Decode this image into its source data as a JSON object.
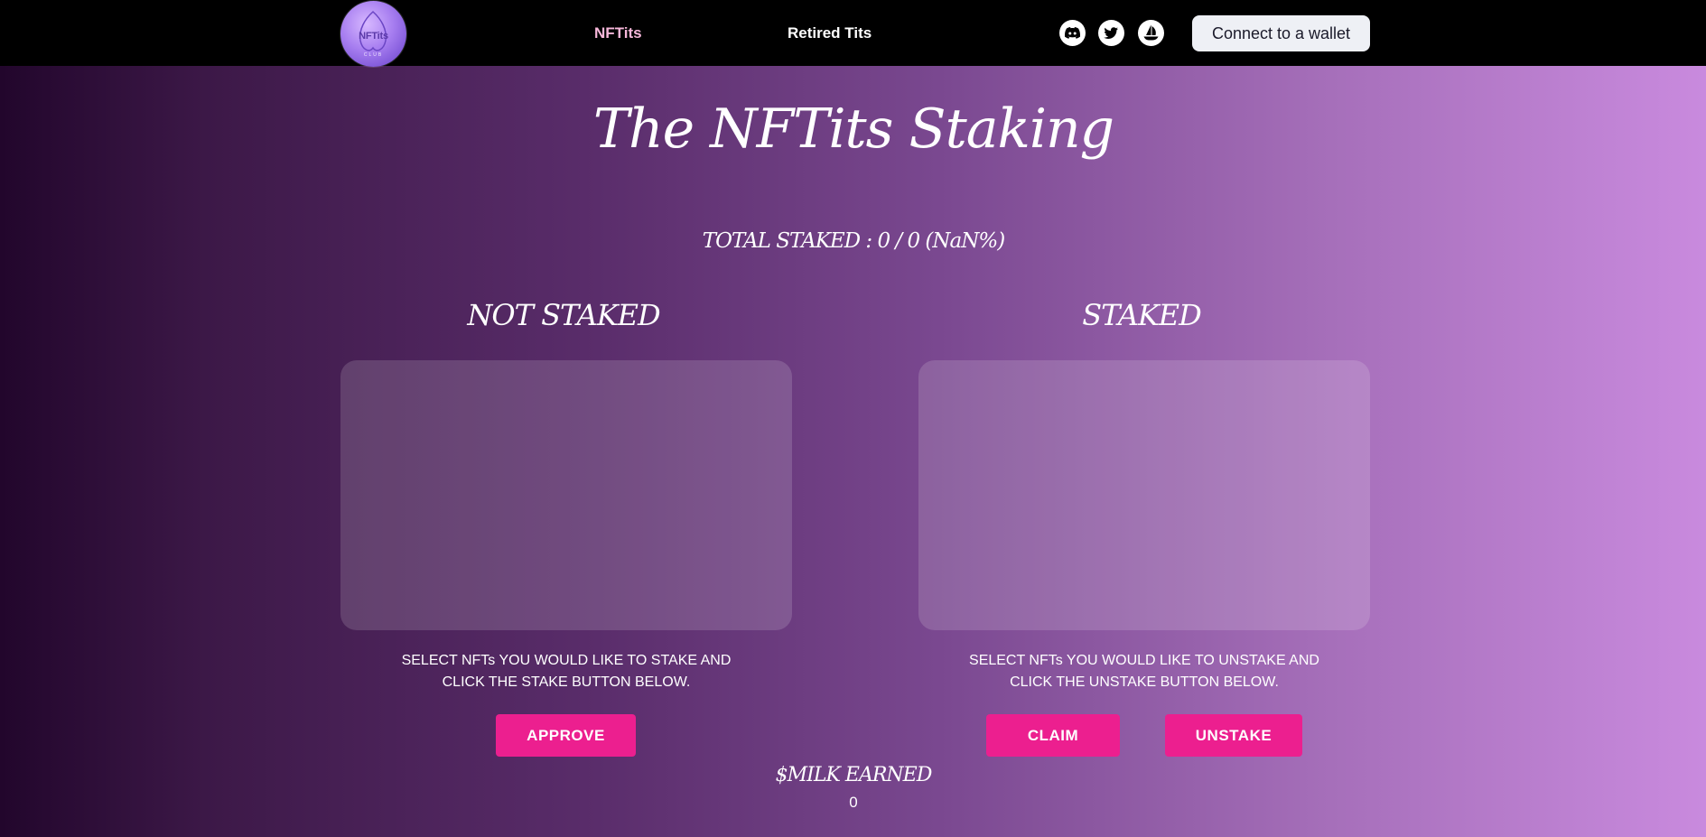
{
  "nav": {
    "logo_text": "NFTits",
    "logo_sub": "CLUB",
    "links": [
      {
        "label": "NFTits",
        "active": true
      },
      {
        "label": "Retired Tits",
        "active": false
      }
    ],
    "social_icons": [
      "discord-icon",
      "twitter-icon",
      "opensea-icon"
    ],
    "wallet_button": "Connect to a wallet"
  },
  "main": {
    "title": "The NFTits Staking",
    "total_staked": "TOTAL STAKED : 0 / 0 (NaN%)",
    "not_staked": {
      "title": "NOT STAKED",
      "instructions_line1": "SELECT NFTs YOU WOULD LIKE TO STAKE AND",
      "instructions_line2": "CLICK THE STAKE BUTTON BELOW.",
      "approve_button": "APPROVE"
    },
    "staked": {
      "title": "STAKED",
      "instructions_line1": "SELECT NFTs YOU WOULD LIKE TO UNSTAKE AND",
      "instructions_line2": "CLICK THE UNSTAKE BUTTON BELOW.",
      "claim_button": "CLAIM",
      "unstake_button": "UNSTAKE"
    },
    "milk_label": "$MILK EARNED",
    "milk_value": "0"
  },
  "colors": {
    "accent_pink": "#ec1f8f",
    "active_link": "#f7b7da",
    "navbar": "#000000"
  }
}
